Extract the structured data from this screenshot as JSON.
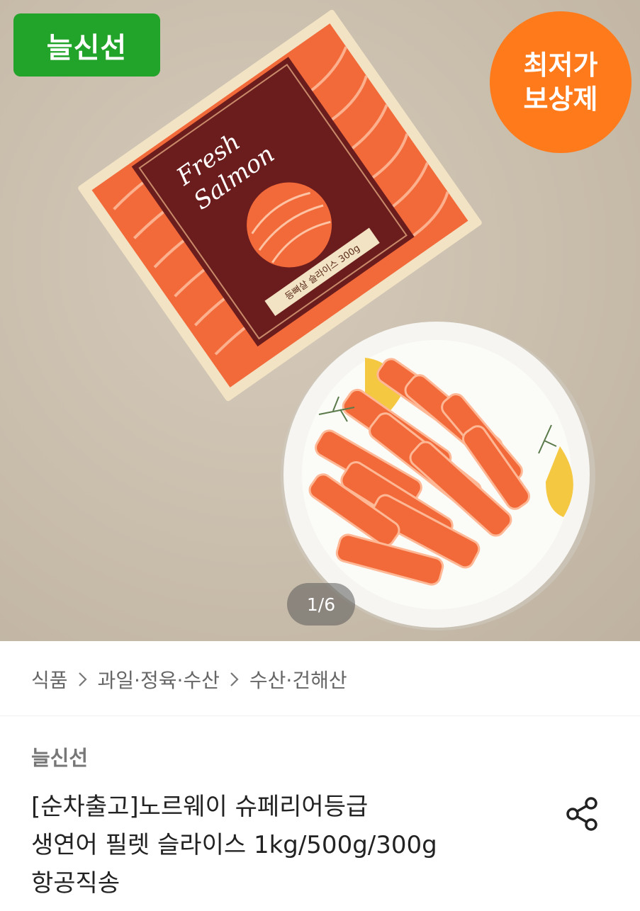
{
  "hero": {
    "brand_badge": "늘신선",
    "price_badge": [
      "최저가",
      "보상제"
    ],
    "package_title": [
      "Fresh",
      "Salmon"
    ],
    "package_label": "등뼈살 슬라이스 300g",
    "pager": "1/6"
  },
  "breadcrumb": {
    "items": [
      "식품",
      "과일·정육·수산",
      "수산·건해산"
    ]
  },
  "product": {
    "seller": "늘신선",
    "title_lines": [
      "[순차출고]노르웨이 슈페리어등급",
      "생연어 필렛 슬라이스 1kg/500g/300g",
      "항공직송"
    ]
  },
  "colors": {
    "brand_green": "#22a32a",
    "badge_orange": "#ff7a1a",
    "salmon": "#f26a3a"
  },
  "icons": {
    "breadcrumb_separator": "chevron-right-icon",
    "share": "share-icon"
  }
}
